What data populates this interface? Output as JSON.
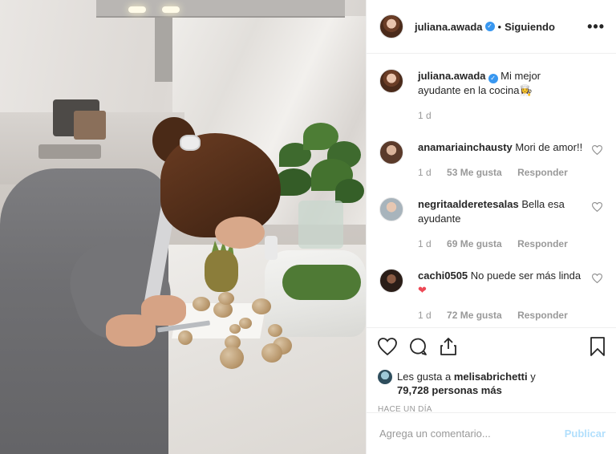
{
  "post": {
    "username": "juliana.awada",
    "follow_status": "Siguiendo",
    "more_glyph": "•••",
    "verified_glyph": "✓",
    "separator": "•"
  },
  "caption": {
    "username": "juliana.awada",
    "text": "Mi mejor ayudante en la cocina",
    "emoji": "👩‍🍳",
    "time": "1 d"
  },
  "comments": [
    {
      "username": "anamariainchausty",
      "text": "Mori de amor!!",
      "time": "1 d",
      "likes": "53 Me gusta",
      "reply": "Responder",
      "avatar_color": "#c9a48a"
    },
    {
      "username": "negritaalderetesalas",
      "text": "Bella esa ayudante",
      "time": "1 d",
      "likes": "69 Me gusta",
      "reply": "Responder",
      "avatar_color": "#b8c0c6"
    },
    {
      "username": "cachi0505",
      "text": "No puede ser más linda",
      "emoji": "❤",
      "time": "1 d",
      "likes": "72 Me gusta",
      "reply": "Responder",
      "avatar_color": "#3a2a22"
    }
  ],
  "icons": {
    "like": "heart-outline-icon",
    "comment": "comment-bubble-icon",
    "share": "share-icon",
    "save": "bookmark-icon",
    "comment_like": "small-heart-icon"
  },
  "likes": {
    "prefix": "Les gusta a ",
    "user": "melisabrichetti",
    "connector": " y",
    "count": "79,728 personas más"
  },
  "timestamp": "HACE UN DÍA",
  "add_comment": {
    "placeholder": "Agrega un comentario...",
    "publish": "Publicar"
  },
  "colors": {
    "link_blue": "#3897f0",
    "publish_disabled": "#b2dffc",
    "muted": "#999999",
    "heart_red": "#ed4956"
  }
}
